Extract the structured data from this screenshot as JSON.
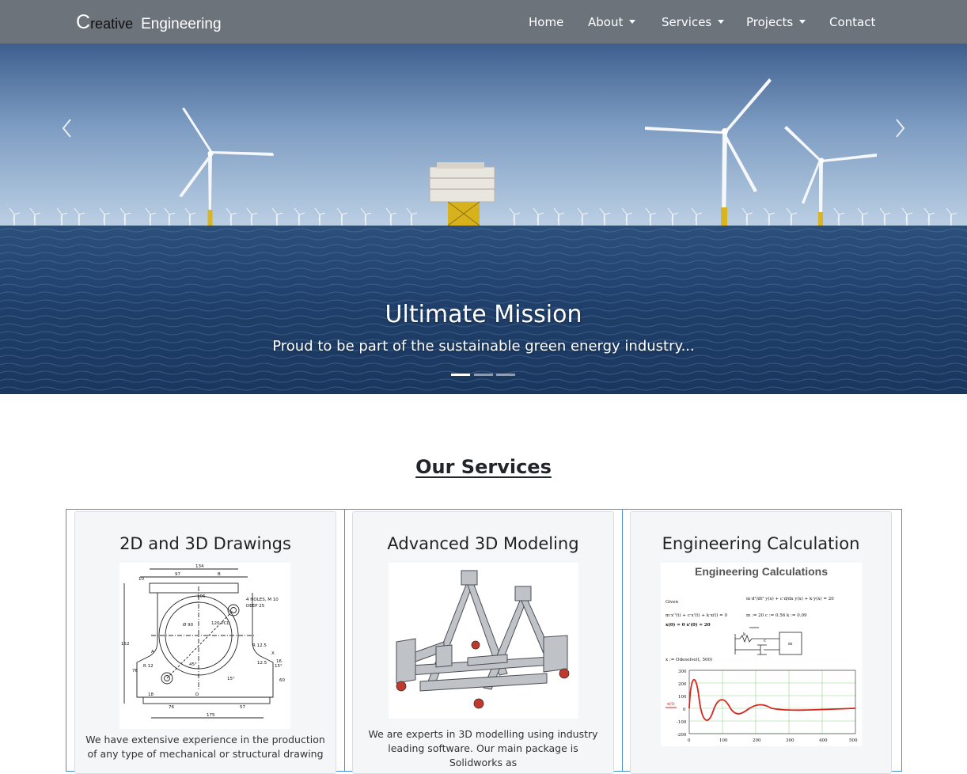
{
  "brand": {
    "initial": "C",
    "rest": "reative",
    "second": "Engineering"
  },
  "nav": {
    "items": [
      {
        "label": "Home"
      },
      {
        "label": "About"
      },
      {
        "label": "Services"
      },
      {
        "label": "Projects"
      },
      {
        "label": "Contact"
      }
    ]
  },
  "hero": {
    "title": "Ultimate Mission",
    "subtitle": "Proud to be part of the sustainable green energy industry...",
    "slides_count": 3,
    "active_slide": 1
  },
  "services": {
    "heading": "Our Services",
    "cards": [
      {
        "title": "2D and 3D Drawings",
        "text": "We have extensive experience in the production of any type of mechanical or structural drawing"
      },
      {
        "title": "Advanced 3D Modeling",
        "text": "We are experts in 3D modelling using industry leading software. Our main package is Solidworks as"
      },
      {
        "title": "Engineering Calculation",
        "image_heading": "Engineering Calculations",
        "given_label": "Given",
        "ode_label": "x := Odesolve(t, 500)"
      }
    ]
  },
  "drawing_labels": {
    "top1": "134",
    "top2": "97",
    "b": "B",
    "mid": "106",
    "holes": "4 HOLES, M 10",
    "deep": "DEEP 25",
    "pcd": "120 PCD",
    "dia": "Ø 90",
    "r125": "R 12.5",
    "r12": "R 12",
    "h152": "152",
    "h76": "76",
    "h10": "10",
    "h18": "18",
    "h60": "60",
    "h16": "16",
    "ang45": "45°",
    "ang15": "15°",
    "ang15b": "15°",
    "w76": "76",
    "w57": "57",
    "w175": "175",
    "la": "A",
    "lx": "X",
    "ld": "D",
    "l125": "12.5"
  },
  "calc_labels": {
    "eq_top": "m·d²/dt² y(x) + c·d/dx y(x) + k·y(x) = 20",
    "eq1": "m·x''(t) + c·x'(t) + k·x(t) = 0",
    "params": "m := 20    c := 0.56    k := 0.09",
    "init": "x(0) = 0    x'(0) = 20",
    "k": "k",
    "c": "c",
    "m": "m",
    "xt": "x(t)",
    "y_ticks": [
      "300",
      "200",
      "100",
      "0",
      "-100",
      "-200"
    ],
    "x_ticks": [
      "0",
      "100",
      "200",
      "300",
      "400",
      "500"
    ]
  }
}
